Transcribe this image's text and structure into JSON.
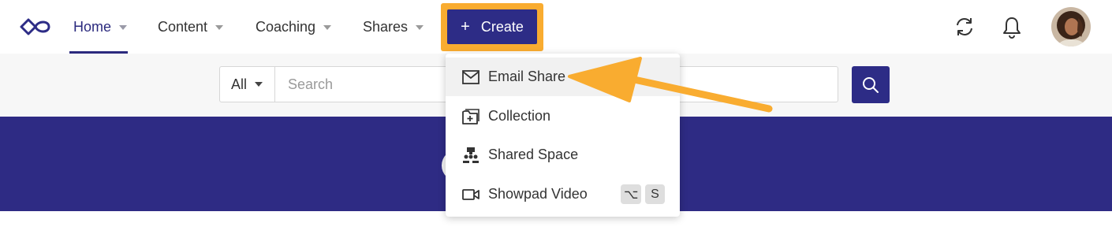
{
  "nav": {
    "items": [
      {
        "label": "Home",
        "active": true
      },
      {
        "label": "Content"
      },
      {
        "label": "Coaching"
      },
      {
        "label": "Shares"
      }
    ],
    "create_label": "Create",
    "create_icon": "plus-icon",
    "right_icons": [
      "sync-icon",
      "bell-icon"
    ],
    "accent_color": "#2d2c86",
    "highlight_color": "#f9ac30"
  },
  "search": {
    "scope": "All",
    "placeholder": "Search",
    "value": ""
  },
  "create_menu": {
    "items": [
      {
        "label": "Email Share",
        "icon": "envelope-icon",
        "hovered": true
      },
      {
        "label": "Collection",
        "icon": "collection-add-icon"
      },
      {
        "label": "Shared Space",
        "icon": "shared-space-icon"
      },
      {
        "label": "Showpad Video",
        "icon": "video-camera-icon",
        "shortcut": [
          "⌥",
          "S"
        ]
      }
    ]
  }
}
